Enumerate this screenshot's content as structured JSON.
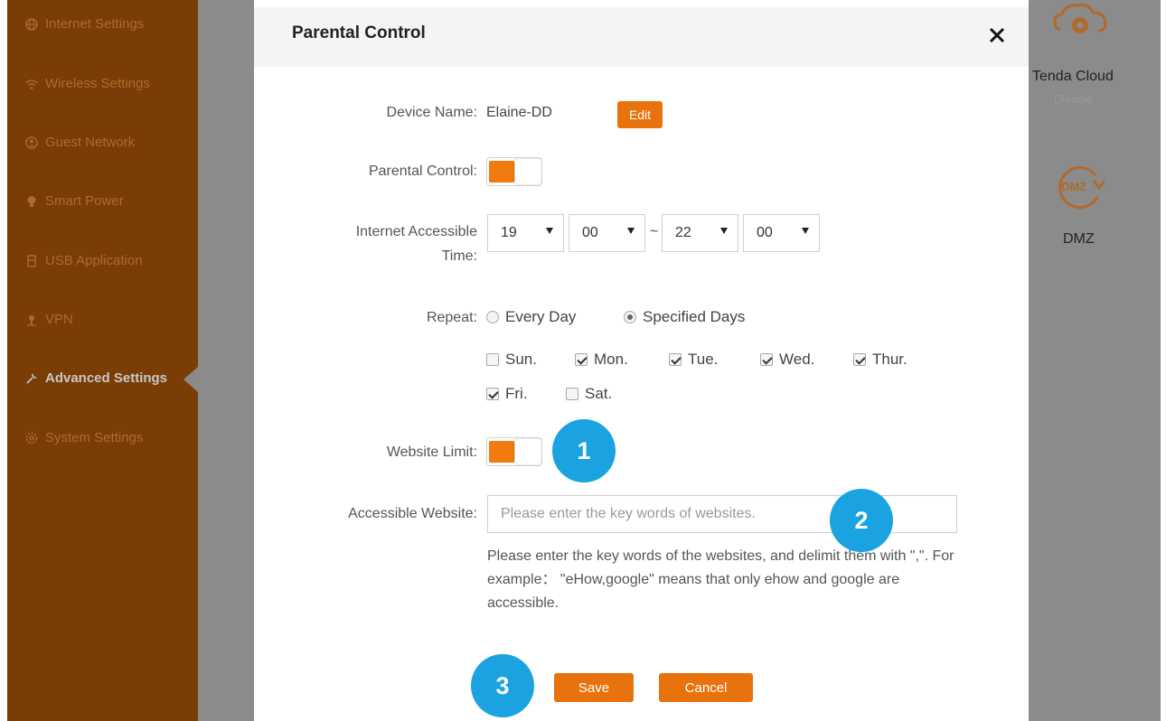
{
  "sidebar": {
    "items": [
      {
        "label": "Internet Settings",
        "icon": "globe-icon"
      },
      {
        "label": "Wireless Settings",
        "icon": "wifi-icon"
      },
      {
        "label": "Guest Network",
        "icon": "guest-network-icon"
      },
      {
        "label": "Smart Power",
        "icon": "bulb-icon"
      },
      {
        "label": "USB Application",
        "icon": "usb-icon"
      },
      {
        "label": "VPN",
        "icon": "vpn-icon"
      },
      {
        "label": "Advanced Settings",
        "icon": "tools-icon",
        "active": true
      },
      {
        "label": "System Settings",
        "icon": "gear-icon"
      }
    ]
  },
  "right_panel": {
    "cloud_label": "Tenda Cloud",
    "cloud_status": "Disable",
    "dmz_icon_text": "DMZ",
    "dmz_label": "DMZ"
  },
  "modal": {
    "title": "Parental Control",
    "close_icon": "close-icon",
    "device_name_label": "Device Name:",
    "device_name_value": "Elaine-DD",
    "edit_label": "Edit",
    "parental_control_label": "Parental Control:",
    "parental_control_on": true,
    "access_time_label_1": "Internet Accessible",
    "access_time_label_2": "Time:",
    "start_hour": "19",
    "start_minute": "00",
    "range_separator": "~",
    "end_hour": "22",
    "end_minute": "00",
    "repeat_label": "Repeat:",
    "repeat_options": [
      {
        "label": "Every Day",
        "selected": false
      },
      {
        "label": "Specified Days",
        "selected": true
      }
    ],
    "days": [
      {
        "label": "Sun.",
        "checked": false
      },
      {
        "label": "Mon.",
        "checked": true
      },
      {
        "label": "Tue.",
        "checked": true
      },
      {
        "label": "Wed.",
        "checked": true
      },
      {
        "label": "Thur.",
        "checked": true
      },
      {
        "label": "Fri.",
        "checked": true
      },
      {
        "label": "Sat.",
        "checked": false
      }
    ],
    "website_limit_label": "Website Limit:",
    "website_limit_on": true,
    "accessible_website_label": "Accessible Website:",
    "accessible_website_placeholder": "Please enter the key words of websites.",
    "accessible_website_value": "",
    "hint_text": "Please enter the key words of the websites, and delimit them with \",\". For example： \"eHow,google\" means that only ehow and google are accessible.",
    "save_label": "Save",
    "cancel_label": "Cancel"
  },
  "annotations": [
    "1",
    "2",
    "3"
  ],
  "colors": {
    "accent": "#e8720c",
    "sidebar_bg": "#7a3d05",
    "overlay": "#8b8b8b",
    "badge": "#1aa3e0"
  }
}
